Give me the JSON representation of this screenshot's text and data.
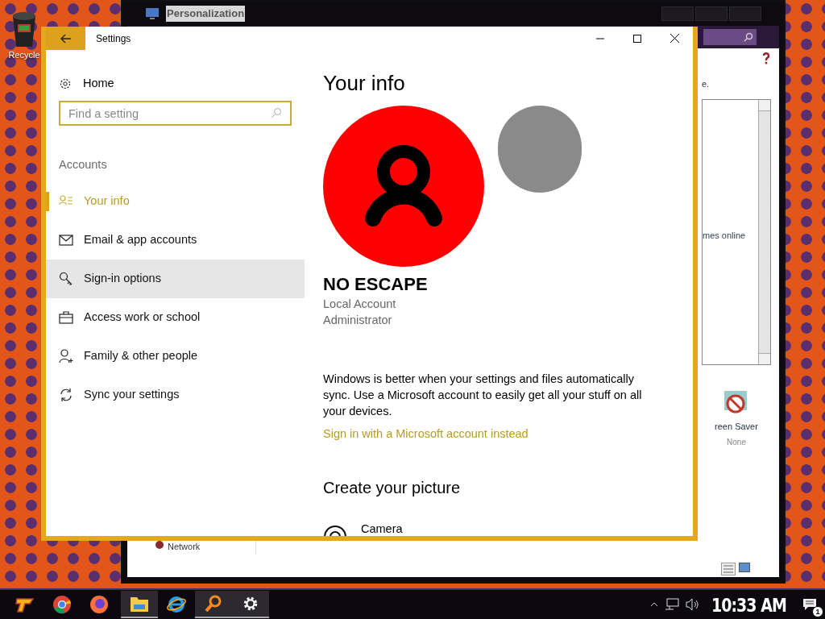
{
  "desktop": {
    "icons": [
      {
        "label": "Recycle"
      }
    ]
  },
  "background_window": {
    "title": "Personalization",
    "description_fragment": "e.",
    "list_item": "mes online",
    "screen_saver": {
      "label": "reen Saver",
      "value": "None"
    },
    "sidebar_link": "Network"
  },
  "settings": {
    "title": "Settings",
    "home": "Home",
    "search": {
      "placeholder": "Find a setting"
    },
    "section": "Accounts",
    "nav": [
      {
        "label": "Your info",
        "selected": true,
        "hovered": false
      },
      {
        "label": "Email & app accounts",
        "selected": false,
        "hovered": false
      },
      {
        "label": "Sign-in options",
        "selected": false,
        "hovered": true
      },
      {
        "label": "Access work or school",
        "selected": false,
        "hovered": false
      },
      {
        "label": "Family & other people",
        "selected": false,
        "hovered": false
      },
      {
        "label": "Sync your settings",
        "selected": false,
        "hovered": false
      }
    ],
    "content": {
      "title": "Your info",
      "name": "NO ESCAPE",
      "details": [
        "Local Account",
        "Administrator"
      ],
      "paragraph": "Windows is better when your settings and files automatically sync. Use a Microsoft account to easily get all your stuff on all your devices.",
      "link": "Sign in with a Microsoft account instead",
      "subheading": "Create your picture",
      "options": [
        {
          "label": "Camera"
        }
      ]
    }
  },
  "taskbar": {
    "apps": [
      {
        "open": false
      },
      {
        "open": false
      },
      {
        "open": false
      },
      {
        "open": true
      },
      {
        "open": false
      },
      {
        "open": true
      },
      {
        "open": true
      }
    ],
    "time": "10:33 AM",
    "notification_count": "1"
  }
}
